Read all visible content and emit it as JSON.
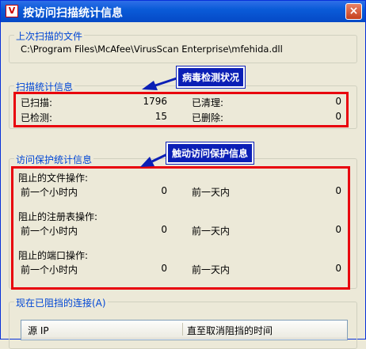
{
  "window": {
    "title": "按访问扫描统计信息",
    "icon": "mcafee-shield-icon",
    "close_label": "×"
  },
  "last_scanned": {
    "legend": "上次扫描的文件",
    "path": "C:\\Program Files\\McAfee\\VirusScan Enterprise\\mfehida.dll"
  },
  "scan_stats": {
    "legend": "扫描统计信息",
    "scanned_label": "已扫描:",
    "scanned_value": "1796",
    "cleaned_label": "已清理:",
    "cleaned_value": "0",
    "detected_label": "已检测:",
    "detected_value": "15",
    "deleted_label": "已删除:",
    "deleted_value": "0"
  },
  "access_protection": {
    "legend": "访问保护统计信息",
    "blocks": [
      {
        "title": "阻止的文件操作:",
        "hour_label": "前一个小时内",
        "hour_value": "0",
        "day_label": "前一天内",
        "day_value": "0"
      },
      {
        "title": "阻止的注册表操作:",
        "hour_label": "前一个小时内",
        "hour_value": "0",
        "day_label": "前一天内",
        "day_value": "0"
      },
      {
        "title": "阻止的端口操作:",
        "hour_label": "前一个小时内",
        "hour_value": "0",
        "day_label": "前一天内",
        "day_value": "0"
      }
    ]
  },
  "blocked_connections": {
    "legend": "现在已阻挡的连接(A)",
    "columns": [
      "源 IP",
      "直至取消阻挡的时间"
    ]
  },
  "annotations": {
    "virus_status": "病毒检测状况",
    "trigger_info": "触动访问保护信息",
    "highlight_color": "#e8000d",
    "callout_color": "#0b1fb6"
  }
}
